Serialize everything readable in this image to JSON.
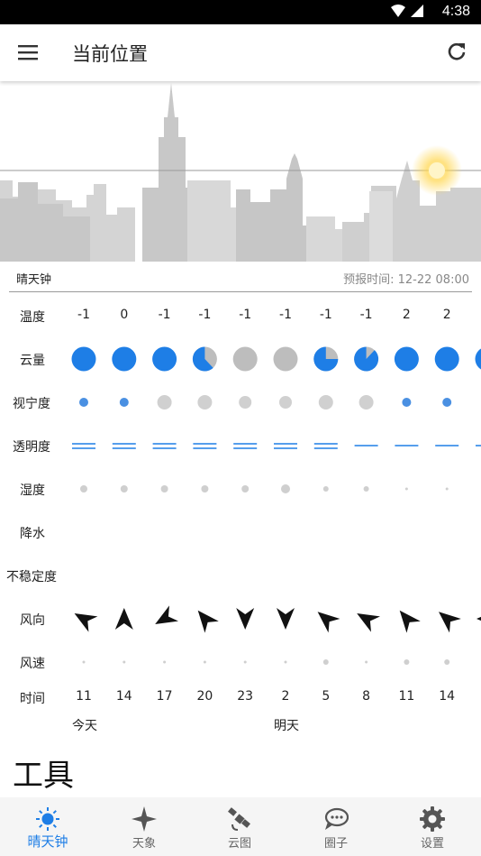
{
  "status_bar": {
    "time": "4:38"
  },
  "app_bar": {
    "title": "当前位置"
  },
  "panel": {
    "name": "晴天钟",
    "forecast_label": "预报时间:",
    "forecast_time": "12-22 08:00"
  },
  "rows": {
    "temperature": "温度",
    "cloud": "云量",
    "seeing": "视宁度",
    "transparency": "透明度",
    "humidity": "湿度",
    "precip": "降水",
    "instability": "不稳定度",
    "wind_dir": "风向",
    "wind_speed": "风速",
    "time": "时间"
  },
  "forecast": {
    "temperatures": [
      "-1",
      "0",
      "-1",
      "-1",
      "-1",
      "-1",
      "-1",
      "-1",
      "2",
      "2"
    ],
    "cloud_cover": [
      1.0,
      1.0,
      1.0,
      0.62,
      1.0,
      1.0,
      0.75,
      0.88,
      1.0,
      1.0,
      1.0
    ],
    "cloud_gray": [
      false,
      false,
      false,
      false,
      true,
      true,
      false,
      false,
      false,
      false,
      false
    ],
    "seeing": [
      "blue-s",
      "blue-s",
      "gray-l",
      "gray-l",
      "gray-m",
      "gray-m",
      "gray-l",
      "gray-l",
      "blue-s",
      "blue-s"
    ],
    "transparency_lines": [
      2,
      2,
      2,
      2,
      2,
      2,
      2,
      1,
      1,
      1,
      1
    ],
    "humidity": [
      "m",
      "m",
      "m",
      "m",
      "m",
      "l",
      "s",
      "s",
      "xs",
      "xs"
    ],
    "wind_dir_deg": [
      -60,
      0,
      -120,
      -40,
      180,
      180,
      -50,
      -60,
      -40,
      -50,
      -90
    ],
    "wind_speed": [
      "xs",
      "xs",
      "xs",
      "xs",
      "xs",
      "xs",
      "s",
      "xs",
      "s",
      "s"
    ],
    "hours": [
      "11",
      "14",
      "17",
      "20",
      "23",
      "2",
      "5",
      "8",
      "11",
      "14"
    ]
  },
  "days": {
    "today": "今天",
    "tomorrow": "明天"
  },
  "tools_title": "工具",
  "tabs": [
    {
      "label": "晴天钟",
      "icon": "sun-icon",
      "active": true
    },
    {
      "label": "天象",
      "icon": "sparkle-icon",
      "active": false
    },
    {
      "label": "云图",
      "icon": "satellite-icon",
      "active": false
    },
    {
      "label": "圈子",
      "icon": "chat-bubble-icon",
      "active": false
    },
    {
      "label": "设置",
      "icon": "gear-icon",
      "active": false
    }
  ],
  "colors": {
    "accent": "#1e7ee6",
    "cloud_gray": "#bdbdbd",
    "skyline": "#cfcfcf",
    "sun": "#ffd21f"
  }
}
